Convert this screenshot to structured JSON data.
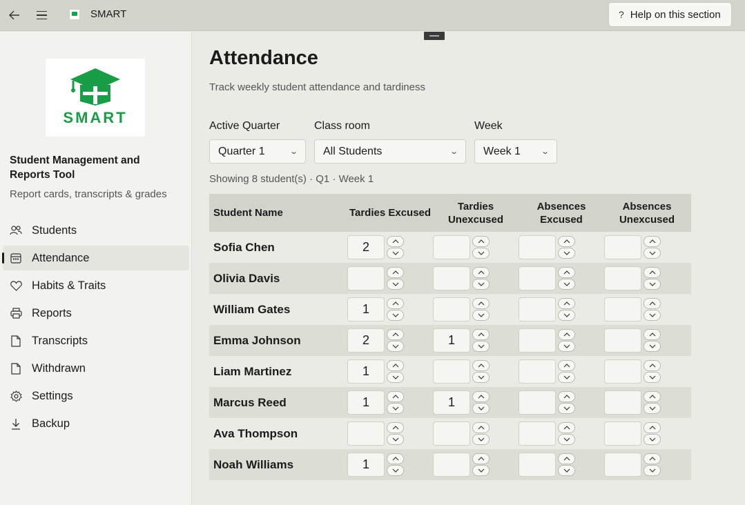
{
  "titlebar": {
    "app_title": "SMART",
    "help_label": "Help on this section",
    "help_icon": "?"
  },
  "sidebar": {
    "logo_text": "SMART",
    "app_name": "Student Management and Reports Tool",
    "app_subtitle": "Report cards, transcripts & grades",
    "nav": [
      {
        "label": "Students",
        "icon": "people-icon",
        "active": false
      },
      {
        "label": "Attendance",
        "icon": "calendar-icon",
        "active": true
      },
      {
        "label": "Habits & Traits",
        "icon": "heart-icon",
        "active": false
      },
      {
        "label": "Reports",
        "icon": "printer-icon",
        "active": false
      },
      {
        "label": "Transcripts",
        "icon": "document-icon",
        "active": false
      },
      {
        "label": "Withdrawn",
        "icon": "document-icon",
        "active": false
      },
      {
        "label": "Settings",
        "icon": "gear-icon",
        "active": false
      },
      {
        "label": "Backup",
        "icon": "download-icon",
        "active": false
      }
    ]
  },
  "page": {
    "title": "Attendance",
    "subtitle": "Track weekly student attendance and tardiness",
    "filters": {
      "quarter": {
        "label": "Active Quarter",
        "value": "Quarter 1"
      },
      "classroom": {
        "label": "Class room",
        "value": "All Students"
      },
      "week": {
        "label": "Week",
        "value": "Week 1"
      }
    },
    "showing_text": "Showing 8 student(s) · Q1 · Week 1"
  },
  "table": {
    "headers": {
      "name": "Student Name",
      "tardies_excused": "Tardies Excused",
      "tardies_unexcused_1": "Tardies",
      "tardies_unexcused_2": "Unexcused",
      "absences_excused_1": "Absences",
      "absences_excused_2": "Excused",
      "absences_unexcused_1": "Absences",
      "absences_unexcused_2": "Unexcused"
    },
    "rows": [
      {
        "name": "Sofia Chen",
        "values": [
          "2",
          "",
          "",
          ""
        ]
      },
      {
        "name": "Olivia Davis",
        "values": [
          "",
          "",
          "",
          ""
        ]
      },
      {
        "name": "William Gates",
        "values": [
          "1",
          "",
          "",
          ""
        ]
      },
      {
        "name": "Emma Johnson",
        "values": [
          "2",
          "1",
          "",
          ""
        ]
      },
      {
        "name": "Liam Martinez",
        "values": [
          "1",
          "",
          "",
          ""
        ]
      },
      {
        "name": "Marcus Reed",
        "values": [
          "1",
          "1",
          "",
          ""
        ]
      },
      {
        "name": "Ava Thompson",
        "values": [
          "",
          "",
          "",
          ""
        ]
      },
      {
        "name": "Noah Williams",
        "values": [
          "1",
          "",
          "",
          ""
        ]
      }
    ]
  },
  "colors": {
    "accent_green": "#1a9d47",
    "background": "#e9ebe4",
    "sidebar": "#f2f3ee"
  }
}
